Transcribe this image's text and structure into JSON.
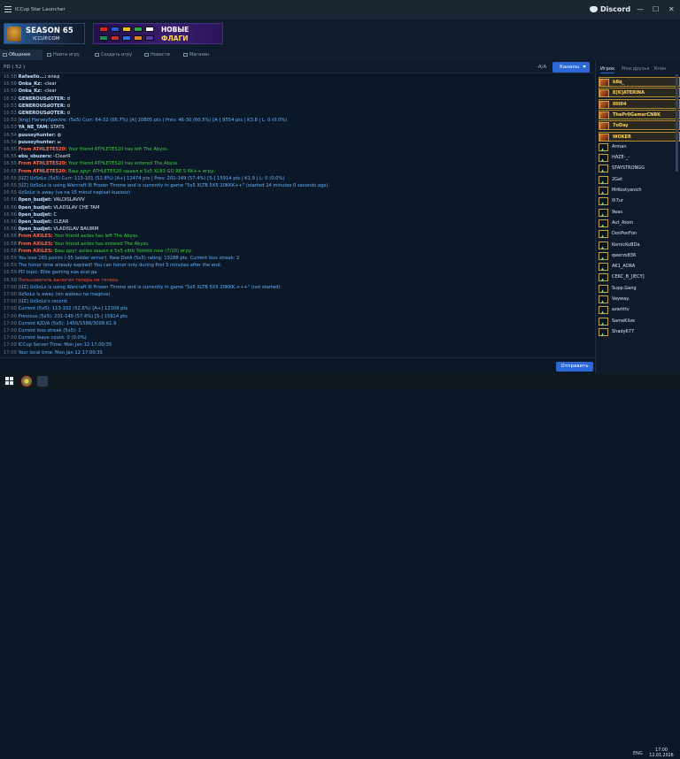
{
  "window": {
    "title": "ICCup Star Launcher",
    "discord_label": "Discord",
    "minimize": "—",
    "maximize": "☐",
    "close": "✕"
  },
  "banners": {
    "season_title": "SEASON 65",
    "season_site": "ICCUP.COM",
    "flags_line1": "НОВЫЕ",
    "flags_line2": "ФЛАГИ"
  },
  "tabs": [
    {
      "label": "Общение"
    },
    {
      "label": "Найти игру"
    },
    {
      "label": "Создать игру"
    },
    {
      "label": "Новости"
    },
    {
      "label": "Магазин"
    }
  ],
  "toolbar": {
    "channel": "PD ( 52 )",
    "font_toggle": "-A/A",
    "channels_button": "Каналы"
  },
  "sidebar": {
    "tabs": [
      "Игрок",
      "Мои друзья",
      "Клан"
    ],
    "users": [
      {
        "name": "b8q_",
        "special": true
      },
      {
        "name": "E[K]ATERINA",
        "special": true
      },
      {
        "name": "lllllll4",
        "special": true
      },
      {
        "name": "ThePr0GamerCNBK",
        "special": true
      },
      {
        "name": "7oDay",
        "special": true
      },
      {
        "name": "WOKER",
        "special": true
      },
      {
        "name": "Arman",
        "special": false
      },
      {
        "name": "HAZE-_-",
        "special": false
      },
      {
        "name": "STAYSTRONGG",
        "special": false
      },
      {
        "name": "2Get",
        "special": false
      },
      {
        "name": "MrKostyanich",
        "special": false
      },
      {
        "name": "0i7ur",
        "special": false
      },
      {
        "name": "9eas",
        "special": false
      },
      {
        "name": "Aut_Atom",
        "special": false
      },
      {
        "name": "DonPonFon",
        "special": false
      },
      {
        "name": "KomicKoBDa",
        "special": false
      },
      {
        "name": "qwerzs836",
        "special": false
      },
      {
        "name": "AK1_AORA",
        "special": false
      },
      {
        "name": "CEKC_B_[IECY]",
        "special": false
      },
      {
        "name": "Supp.Gang",
        "special": false
      },
      {
        "name": "Vayway.",
        "special": false
      },
      {
        "name": "azartttv",
        "special": false
      },
      {
        "name": "SameKilze",
        "special": false
      },
      {
        "name": "Shady677",
        "special": false
      }
    ]
  },
  "chat": [
    {
      "ts": "16:58",
      "nick": "Rafaello...:",
      "msg": "влад",
      "type": "user"
    },
    {
      "ts": "16:58",
      "nick": "Onka_Kz:",
      "msg": "-clear",
      "type": "user"
    },
    {
      "ts": "16:59",
      "nick": "Onka_Kz:",
      "msg": "-clear",
      "type": "user"
    },
    {
      "ts": "16:52",
      "nick": "GENEROUSdOTER:",
      "msg": "d",
      "type": "user"
    },
    {
      "ts": "16:53",
      "nick": "GENEROUSdOTER:",
      "msg": "d",
      "type": "user"
    },
    {
      "ts": "16:53",
      "nick": "GENEROUSdOTER:",
      "msg": "d",
      "type": "user"
    },
    {
      "ts": "16:53",
      "nick": "",
      "msg": "[kng] HarveySpectre: (5x5) Curr: 64-32 (66.7%) [A] 10805 pts | Prev: 46-30 (60.5%) [A-] 9554 pts | K3.8 | L: 0 (0.0%)",
      "type": "sys"
    },
    {
      "ts": "16:53",
      "nick": "YA_NE_TAM:",
      "msg": "STATS",
      "type": "user"
    },
    {
      "ts": "16:54",
      "nick": "puussyhunter:",
      "msg": "ф",
      "type": "user"
    },
    {
      "ts": "16:54",
      "nick": "puussyhunter:",
      "msg": "ы",
      "type": "user"
    },
    {
      "ts": "16:55",
      "nick": "From ATHLETE520:",
      "msg": "Your friend ATHLETE520 has left The Abyss.",
      "type": "green"
    },
    {
      "ts": "16:55",
      "nick": "ebu_sbuzers:",
      "msg": "-ClearR",
      "type": "user"
    },
    {
      "ts": "16:55",
      "nick": "From ATHLETE520:",
      "msg": "Your friend ATHLETE520 has entered The Abyss.",
      "type": "green"
    },
    {
      "ts": "16:55",
      "nick": "From ATHLETE520:",
      "msg": "Ваш друг ATHLETE520 зашел в 5x5 XL83 GO RE.5.6K++ игру.",
      "type": "green"
    },
    {
      "ts": "16:55",
      "nick": "",
      "msg": "[UZ] UzSoLo (5x5) Curr: 113-101 (52.8%) [A+] 12474 pts | Prev: 201-149 (57.4%) [S-] 15914 pts | K1.9 | L: 0 (0.0%)",
      "type": "sys"
    },
    {
      "ts": "16:55",
      "nick": "",
      "msg": "[UZ] UzSoLo is using Warcraft III Frozen Throne and is currently in  game \"5x5 XLTB 5X5 20KKK++\" (started 24 minutes 0 seconds ago).",
      "type": "sys"
    },
    {
      "ts": "16:55",
      "nick": "",
      "msg": "UzSoLo is away (va na 15 minut napisat kuessiz)",
      "type": "sys"
    },
    {
      "ts": "16:56",
      "nick": "0pen_budjet:",
      "msg": "VALDISLAVVV",
      "type": "user"
    },
    {
      "ts": "16:56",
      "nick": "0pen_budjet:",
      "msg": "VLADSLAV CHE TAM",
      "type": "user"
    },
    {
      "ts": "16:56",
      "nick": "0pen_budjet:",
      "msg": "C",
      "type": "user"
    },
    {
      "ts": "16:56",
      "nick": "0pen_budjet:",
      "msg": "CLEAR",
      "type": "user"
    },
    {
      "ts": "16:56",
      "nick": "0pen_budjet:",
      "msg": "VLADISLAV BAUIRM",
      "type": "user"
    },
    {
      "ts": "16:58",
      "nick": "From AXILES:",
      "msg": "Your friend axiles has left The Abyss.",
      "type": "green"
    },
    {
      "ts": "16:58",
      "nick": "From AXILES:",
      "msg": "Your friend axiles has entered The Abyss.",
      "type": "green"
    },
    {
      "ts": "16:58",
      "nick": "From AXILES:",
      "msg": "Ваш друг axiles зашел в 5x5 xlttb 5kkkkk new (7/10) игру.",
      "type": "green"
    },
    {
      "ts": "16:59",
      "nick": "",
      "msg": "You lose 165 points (-55 ladder armor). New DotA (5x5) rating: 13288 pts. Current loss streak: 2",
      "type": "sys"
    },
    {
      "ts": "16:59",
      "nick": "",
      "msg": "The honor time already expired! You can honor only during first 5 minutes after the end.",
      "type": "sys"
    },
    {
      "ts": "16:59",
      "nick": "",
      "msg": "PD topic: Elite gaming как всегда",
      "type": "sys"
    },
    {
      "ts": "16:59",
      "nick": "",
      "msg": "Пользователь вылогин теперь не теперь",
      "type": "redhl"
    },
    {
      "ts": "17:00",
      "nick": "",
      "msg": "[UZ] UzSoLo is using Warcraft III Frozen Throne and is currently in  game \"5x5 XLTB 5X5 20KKK.+++\" (not started)",
      "type": "sys"
    },
    {
      "ts": "17:00",
      "nick": "",
      "msg": "UzSoLo is away (sin waleeu na magnus)",
      "type": "sys"
    },
    {
      "ts": "17:00",
      "nick": "",
      "msg": "[UZ] UzSoLo's record:",
      "type": "sys"
    },
    {
      "ts": "17:00",
      "nick": "",
      "msg": "Current (5x5): 113-102 (52.6%) [A+] 12309 pts",
      "type": "sys"
    },
    {
      "ts": "17:00",
      "nick": "",
      "msg": "Previous (5x5): 201-149 (57.4%) [S-] 15914 pts",
      "type": "sys"
    },
    {
      "ts": "17:00",
      "nick": "",
      "msg": "Current K/D/A (5x5): 1450/1588/3009 K1.9",
      "type": "sys"
    },
    {
      "ts": "17:00",
      "nick": "",
      "msg": "Current loss streak (5x5): 1",
      "type": "sys"
    },
    {
      "ts": "17:00",
      "nick": "",
      "msg": "Current leave count: 0 (0.0%)",
      "type": "sys"
    },
    {
      "ts": "17:00",
      "nick": "",
      "msg": "ICCup Server Time: Mon Jan 12 17:00:35",
      "type": "sys"
    },
    {
      "ts": "17:00",
      "nick": "",
      "msg": "Your local time: Mon Jan 12 17:00:35",
      "type": "sys"
    }
  ],
  "footer": {
    "send_button": "Отправить"
  },
  "taskbar": {
    "lang": "ENG",
    "time": "17:00",
    "date": "12.01.2026"
  }
}
